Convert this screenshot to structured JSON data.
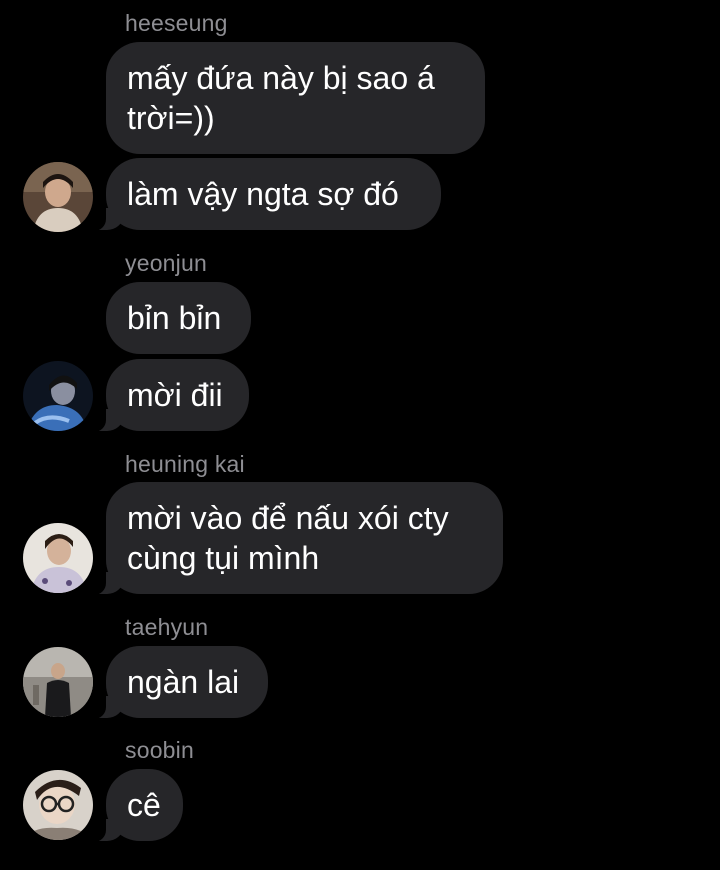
{
  "messages": [
    {
      "sender": "heeseung",
      "bubbles": [
        "mấy đứa này bị sao á trời=))",
        "làm vậy ngta sợ đó"
      ],
      "avatar_icon": "heeseung-avatar-icon"
    },
    {
      "sender": "yeonjun",
      "bubbles": [
        "bỉn bỉn",
        "mời đii"
      ],
      "avatar_icon": "yeonjun-avatar-icon"
    },
    {
      "sender": "heuning kai",
      "bubbles": [
        "mời vào để nấu xói cty cùng tụi mình"
      ],
      "avatar_icon": "heuning-kai-avatar-icon"
    },
    {
      "sender": "taehyun",
      "bubbles": [
        "ngàn lai"
      ],
      "avatar_icon": "taehyun-avatar-icon"
    },
    {
      "sender": "soobin",
      "bubbles": [
        "cê"
      ],
      "avatar_icon": "soobin-avatar-icon"
    }
  ],
  "colors": {
    "background": "#000000",
    "bubble": "#262629",
    "sender_name": "#8e8e93",
    "text": "#ffffff"
  }
}
